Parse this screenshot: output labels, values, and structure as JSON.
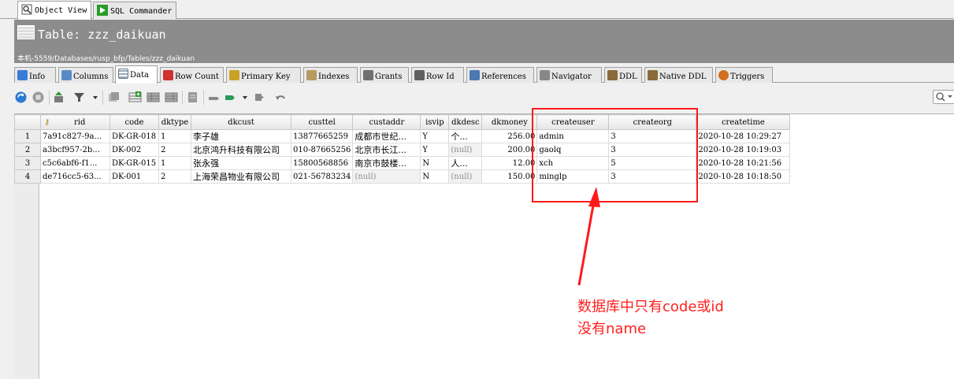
{
  "top_tabs": [
    {
      "label": "Object View",
      "icon": "object-view-icon"
    },
    {
      "label": "SQL Commander",
      "icon": "sql-commander-icon"
    }
  ],
  "header": {
    "title": "Table: zzz_daikuan",
    "breadcrumb": "本机-5559/Databases/rusp_bfp/Tables/zzz_daikuan"
  },
  "sub_tabs": [
    {
      "label": "Info",
      "color": "#3a7bd5"
    },
    {
      "label": "Columns",
      "color": "#5a8ac6"
    },
    {
      "label": "Data",
      "color": "#6c8fb8"
    },
    {
      "label": "Row Count",
      "color": "#d03030"
    },
    {
      "label": "Primary Key",
      "color": "#c9a227"
    },
    {
      "label": "Indexes",
      "color": "#b89a60"
    },
    {
      "label": "Grants",
      "color": "#707070"
    },
    {
      "label": "Row Id",
      "color": "#606060"
    },
    {
      "label": "References",
      "color": "#4a7ab0"
    },
    {
      "label": "Navigator",
      "color": "#888888"
    },
    {
      "label": "DDL",
      "color": "#8a6a3a"
    },
    {
      "label": "Native DDL",
      "color": "#8a6a3a"
    },
    {
      "label": "Triggers",
      "color": "#d07020"
    }
  ],
  "table": {
    "columns": [
      "rid",
      "code",
      "dktype",
      "dkcust",
      "custtel",
      "custaddr",
      "isvip",
      "dkdesc",
      "dkmoney",
      "createuser",
      "createorg",
      "createtime"
    ],
    "rows": [
      {
        "num": "1",
        "cells": [
          "7a91c827-9a...",
          "DK-GR-018",
          "1",
          "李子雄",
          "13877665259",
          "成都市世纪...",
          "Y",
          "个...",
          "256.00",
          "admin",
          "3",
          "2020-10-28 10:29:27"
        ]
      },
      {
        "num": "2",
        "cells": [
          "a3bcf957-2b...",
          "DK-002",
          "2",
          "北京鸿升科技有限公司",
          "010-87665256",
          "北京市长江...",
          "Y",
          "(null)",
          "200.00",
          "gaolq",
          "3",
          "2020-10-28 10:19:03"
        ]
      },
      {
        "num": "3",
        "cells": [
          "c5c6abf6-f1...",
          "DK-GR-015",
          "1",
          "张永强",
          "15800568856",
          "南京市鼓楼...",
          "N",
          "人...",
          "12.00",
          "xch",
          "5",
          "2020-10-28 10:21:56"
        ]
      },
      {
        "num": "4",
        "cells": [
          "de716cc5-63...",
          "DK-001",
          "2",
          "上海荣昌物业有限公司",
          "021-56783234",
          "(null)",
          "N",
          "(null)",
          "150.00",
          "minglp",
          "3",
          "2020-10-28 10:18:50"
        ]
      }
    ]
  },
  "annotation": {
    "line1": "数据库中只有code或id",
    "line2": "没有name",
    "color": "#ff2020"
  }
}
